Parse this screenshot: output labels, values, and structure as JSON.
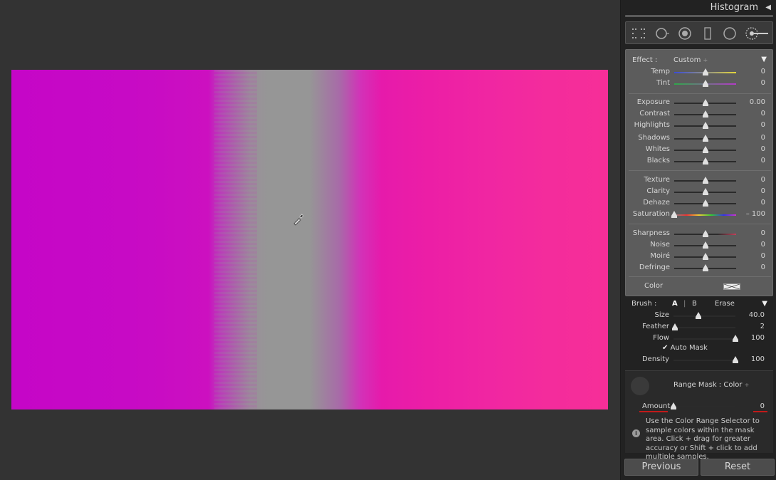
{
  "histogram": {
    "title": "Histogram",
    "toggle_icon": "◀"
  },
  "effect": {
    "label": "Effect :",
    "value": "Custom",
    "value_suffix": "÷",
    "collapse_icon": "▼"
  },
  "sliders": [
    {
      "id": "temp",
      "label": "Temp",
      "value": "0",
      "pos": 0.5,
      "track": "temp"
    },
    {
      "id": "tint",
      "label": "Tint",
      "value": "0",
      "pos": 0.5,
      "track": "tint"
    },
    {
      "id": "exposure",
      "label": "Exposure",
      "value": "0.00",
      "pos": 0.5
    },
    {
      "id": "contrast",
      "label": "Contrast",
      "value": "0",
      "pos": 0.5
    },
    {
      "id": "highlights",
      "label": "Highlights",
      "value": "0",
      "pos": 0.5
    },
    {
      "id": "shadows",
      "label": "Shadows",
      "value": "0",
      "pos": 0.5
    },
    {
      "id": "whites",
      "label": "Whites",
      "value": "0",
      "pos": 0.5
    },
    {
      "id": "blacks",
      "label": "Blacks",
      "value": "0",
      "pos": 0.5
    },
    {
      "id": "texture",
      "label": "Texture",
      "value": "0",
      "pos": 0.5
    },
    {
      "id": "clarity",
      "label": "Clarity",
      "value": "0",
      "pos": 0.5
    },
    {
      "id": "dehaze",
      "label": "Dehaze",
      "value": "0",
      "pos": 0.5
    },
    {
      "id": "saturation",
      "label": "Saturation",
      "value": "– 100",
      "pos": 0.0,
      "track": "saturation"
    },
    {
      "id": "sharpness",
      "label": "Sharpness",
      "value": "0",
      "pos": 0.5,
      "track": "sharpness"
    },
    {
      "id": "noise",
      "label": "Noise",
      "value": "0",
      "pos": 0.5
    },
    {
      "id": "moire",
      "label": "Moiré",
      "value": "0",
      "pos": 0.5
    },
    {
      "id": "defringe",
      "label": "Defringe",
      "value": "0",
      "pos": 0.5
    }
  ],
  "color_label": "Color",
  "brush": {
    "label": "Brush :",
    "tab_a": "A",
    "tab_sep": "|",
    "tab_b": "B",
    "tab_erase": "Erase",
    "collapse_icon": "▼",
    "sliders": [
      {
        "id": "size",
        "label": "Size",
        "value": "40.0",
        "pos": 0.4
      },
      {
        "id": "feather",
        "label": "Feather",
        "value": "2",
        "pos": 0.02
      },
      {
        "id": "flow",
        "label": "Flow",
        "value": "100",
        "pos": 1.0
      },
      {
        "id": "density",
        "label": "Density",
        "value": "100",
        "pos": 1.0
      }
    ],
    "auto_mask_label": "Auto Mask",
    "auto_mask_checked": true
  },
  "range_mask": {
    "label": "Range Mask : Color",
    "suffix": "÷",
    "amount_label": "Amount",
    "amount_value": "0",
    "amount_pos": 0.0,
    "info_icon": "i",
    "info_text": "Use the Color Range Selector to sample colors within the mask area. Click + drag for greater accuracy or Shift + click to add multiple samples."
  },
  "buttons": {
    "previous": "Previous",
    "reset": "Reset"
  },
  "colors": {
    "magenta": "#c506c7",
    "pink": "#f62e98",
    "gray": "#969696"
  }
}
